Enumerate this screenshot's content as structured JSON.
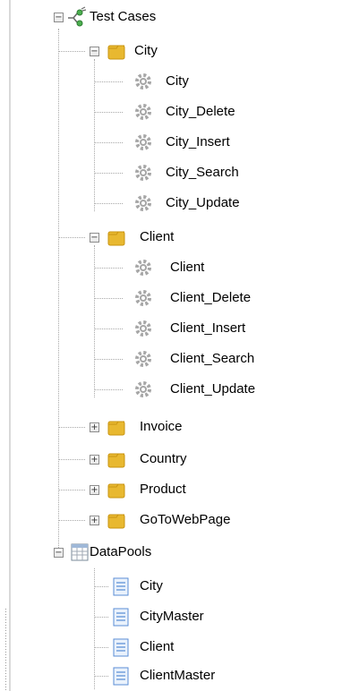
{
  "tree": {
    "test_cases": {
      "label": "Test Cases",
      "icon": "test-cases-icon",
      "folders": [
        {
          "label": "City",
          "expanded": true,
          "children": [
            "City",
            "City_Delete",
            "City_Insert",
            "City_Search",
            "City_Update"
          ]
        },
        {
          "label": "Client",
          "expanded": true,
          "children": [
            "Client",
            "Client_Delete",
            "Client_Insert",
            "Client_Search",
            "Client_Update"
          ]
        },
        {
          "label": "Invoice",
          "expanded": false
        },
        {
          "label": "Country",
          "expanded": false
        },
        {
          "label": "Product",
          "expanded": false
        },
        {
          "label": "GoToWebPage",
          "expanded": false
        }
      ]
    },
    "data_pools": {
      "label": "DataPools",
      "icon": "datapools-icon",
      "children": [
        "City",
        "CityMaster",
        "Client",
        "ClientMaster"
      ]
    }
  },
  "colors": {
    "folder": "#e8b830",
    "gear": "#a6a6a6",
    "doc": "#5b8ed6",
    "guide_line": "#a8a8a8"
  }
}
